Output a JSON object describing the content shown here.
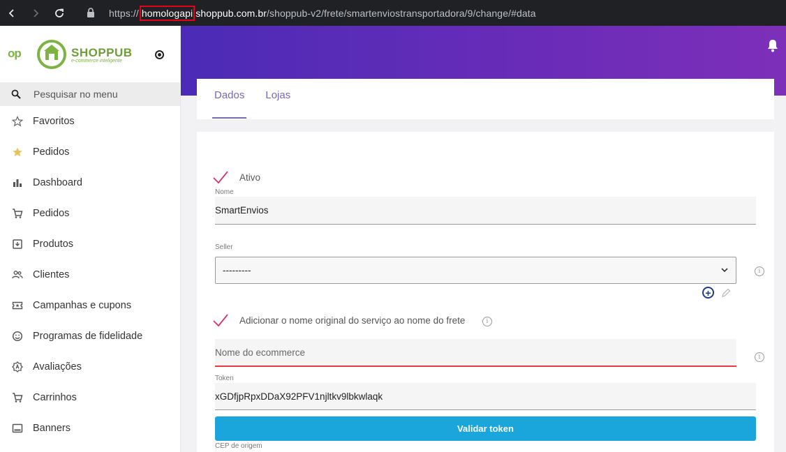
{
  "browser": {
    "url_prefix": "https://",
    "url_highlight": "homologapi",
    "url_domain": "shoppub.com.br",
    "url_path": "/shoppub-v2/frete/smartenviostransportadora/9/change/#data"
  },
  "sidebar": {
    "op_logo": "op",
    "brand_name": "SHOPPUB",
    "brand_tagline": "e-commerce inteligente",
    "search_placeholder": "Pesquisar no menu",
    "items": [
      {
        "label": "Favoritos",
        "icon": "star-outline-icon"
      },
      {
        "label": "Pedidos",
        "icon": "star-filled-icon"
      },
      {
        "label": "Dashboard",
        "icon": "bar-chart-icon"
      },
      {
        "label": "Pedidos",
        "icon": "cart-icon"
      },
      {
        "label": "Produtos",
        "icon": "archive-icon"
      },
      {
        "label": "Clientes",
        "icon": "people-icon"
      },
      {
        "label": "Campanhas e cupons",
        "icon": "ticket-icon"
      },
      {
        "label": "Programas de fidelidade",
        "icon": "smile-icon"
      },
      {
        "label": "Avaliações",
        "icon": "badge-icon"
      },
      {
        "label": "Carrinhos",
        "icon": "cart-icon"
      },
      {
        "label": "Banners",
        "icon": "banner-icon"
      }
    ]
  },
  "tabs": [
    {
      "label": "Dados",
      "active": true
    },
    {
      "label": "Lojas",
      "active": false
    }
  ],
  "form": {
    "ativo_label": "Ativo",
    "ativo_checked": true,
    "nome_label": "Nome",
    "nome_value": "SmartEnvios",
    "seller_label": "Seller",
    "seller_value": "---------",
    "add_service_label": "Adicionar o nome original do serviço ao nome do frete",
    "add_service_checked": true,
    "ecommerce_placeholder": "Nome do ecommerce",
    "token_label": "Token",
    "token_value": "xGDfjpRpxDDaX92PFV1njltkv9lbkwlaqk",
    "validate_button": "Validar token",
    "cep_label": "CEP de origem"
  },
  "colors": {
    "accent_purple": "#4b2bb6",
    "check_pink": "#d6336c",
    "button_blue": "#1aa6da",
    "error_red": "#e53945"
  }
}
